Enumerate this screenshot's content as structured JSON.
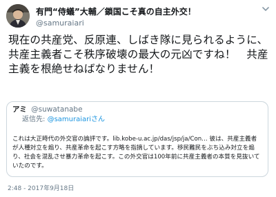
{
  "author": {
    "display_name": "有門“侍蟻”大輔／鎖国こそ真の自主外交！",
    "handle": "@samuraiari"
  },
  "tweet": {
    "text": "現在の共産党、反原連、しばき隊に見られるように、共産主義者こそ秩序破壊の最大の元凶ですね！　共産主義を根絶せねばなりません！",
    "timestamp": "2:48 - 2017年9月18日"
  },
  "quoted": {
    "display_name": "アミ",
    "handle": "@suwatanabe",
    "reply_prefix": "返信先:",
    "reply_handle": "@samuraiariさん",
    "text": "これは大正時代の外交官の論評です。lib.kobe-u.ac.jp/das/jsp/ja/Con… 彼は、共産主義者が人種対立を煽り、共産革命を起こす方略を指摘しています。移民難民をぶち込み対立を煽り、社会を混乱させ暴力革命を起こす。この外交官は100年前に共産主義者の本質を見抜いていたのです。"
  },
  "icons": {
    "avatar": "profile-photo",
    "menu": "chevron-down-icon"
  },
  "colors": {
    "text": "#14171a",
    "secondary": "#657786",
    "link": "#1b95e0",
    "border": "#ccd6dd"
  }
}
